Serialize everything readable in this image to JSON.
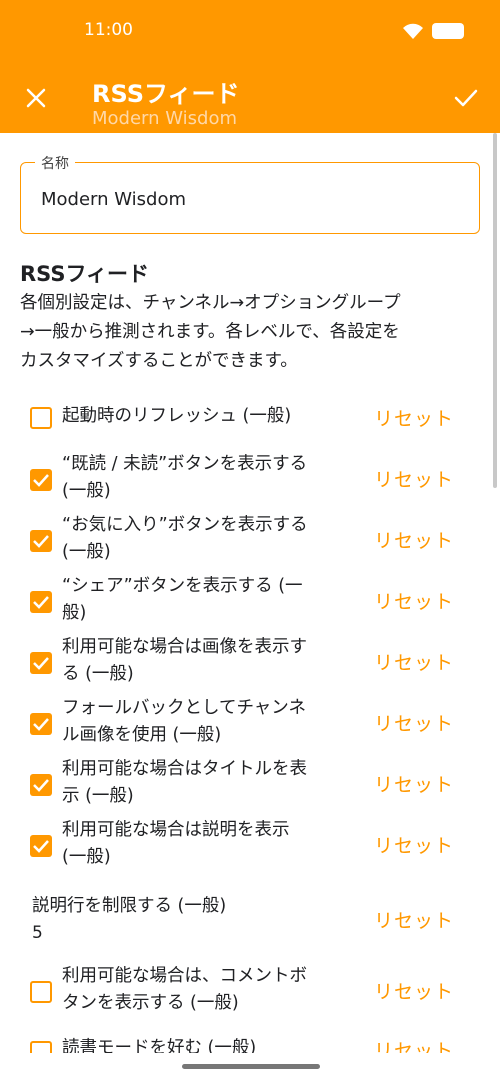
{
  "status": {
    "time": "11:00"
  },
  "appbar": {
    "title": "RSSフィード",
    "subtitle": "Modern Wisdom"
  },
  "name_field": {
    "label": "名称",
    "value": "Modern Wisdom"
  },
  "section": {
    "title": "RSSフィード",
    "desc_lines": [
      "各個別設定は、チャンネル→オプショングループ",
      "→一般から推測されます。各レベルで、各設定を",
      "カスタマイズすることができます。"
    ]
  },
  "reset_label": "リセット",
  "rows": [
    {
      "lines": [
        "起動時のリフレッシュ (一般)"
      ],
      "checked": false
    },
    {
      "lines": [
        "“既読 / 未読”ボタンを表示する",
        "(一般)"
      ],
      "checked": true
    },
    {
      "lines": [
        "“お気に入り”ボタンを表示する",
        "(一般)"
      ],
      "checked": true
    },
    {
      "lines": [
        "“シェア”ボタンを表示する (一",
        "般)"
      ],
      "checked": true
    },
    {
      "lines": [
        "利用可能な場合は画像を表示す",
        "る (一般)"
      ],
      "checked": true
    },
    {
      "lines": [
        "フォールバックとしてチャンネ",
        "ル画像を使用 (一般)"
      ],
      "checked": true
    },
    {
      "lines": [
        "利用可能な場合はタイトルを表",
        "示 (一般)"
      ],
      "checked": true
    },
    {
      "lines": [
        "利用可能な場合は説明を表示",
        "(一般)"
      ],
      "checked": true
    },
    {
      "lines": [
        "説明行を制限する (一般)"
      ],
      "value": "5"
    },
    {
      "lines": [
        "利用可能な場合は、コメントボ",
        "タンを表示する (一般)"
      ],
      "checked": false
    },
    {
      "lines": [
        "読書モードを好む (一般)"
      ],
      "checked": false
    }
  ],
  "colors": {
    "accent": "#FF9800"
  }
}
